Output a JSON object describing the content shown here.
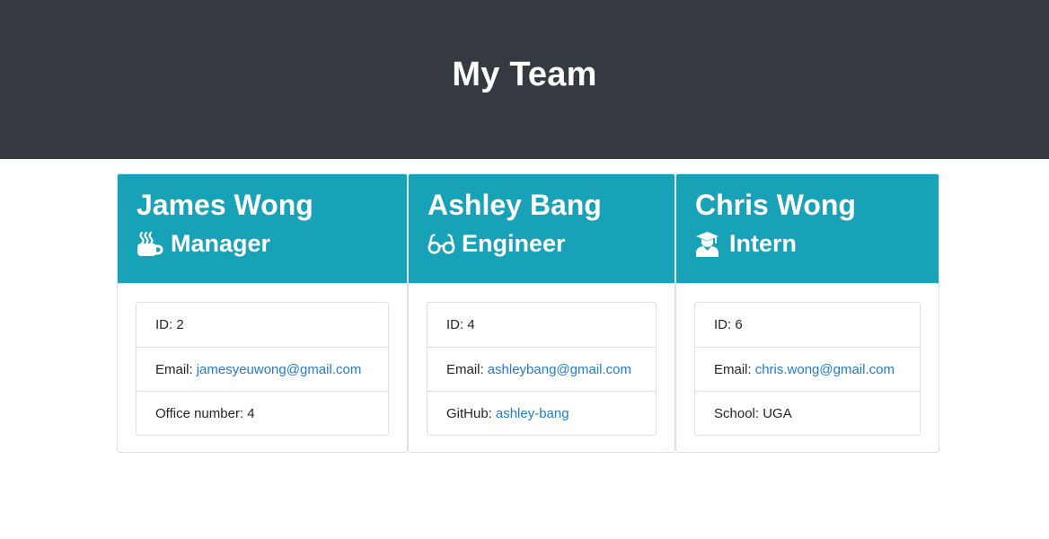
{
  "header": {
    "title": "My Team"
  },
  "team": [
    {
      "name": "James Wong",
      "role": "Manager",
      "icon": "coffee-mug-icon",
      "id_label": "ID:",
      "id": "2",
      "email_label": "Email:",
      "email": "jamesyeuwong@gmail.com",
      "extra_label": "Office number:",
      "extra": "4"
    },
    {
      "name": "Ashley Bang",
      "role": "Engineer",
      "icon": "glasses-icon",
      "id_label": "ID:",
      "id": "4",
      "email_label": "Email:",
      "email": "ashleybang@gmail.com",
      "extra_label": "GitHub:",
      "extra": "ashley-bang"
    },
    {
      "name": "Chris Wong",
      "role": "Intern",
      "icon": "graduate-icon",
      "id_label": "ID:",
      "id": "6",
      "email_label": "Email:",
      "email": "chris.wong@gmail.com",
      "extra_label": "School:",
      "extra": "UGA"
    }
  ],
  "colors": {
    "header_bg": "#343a40",
    "card_header_bg": "#17a2b8",
    "link": "#1f7bd3"
  }
}
